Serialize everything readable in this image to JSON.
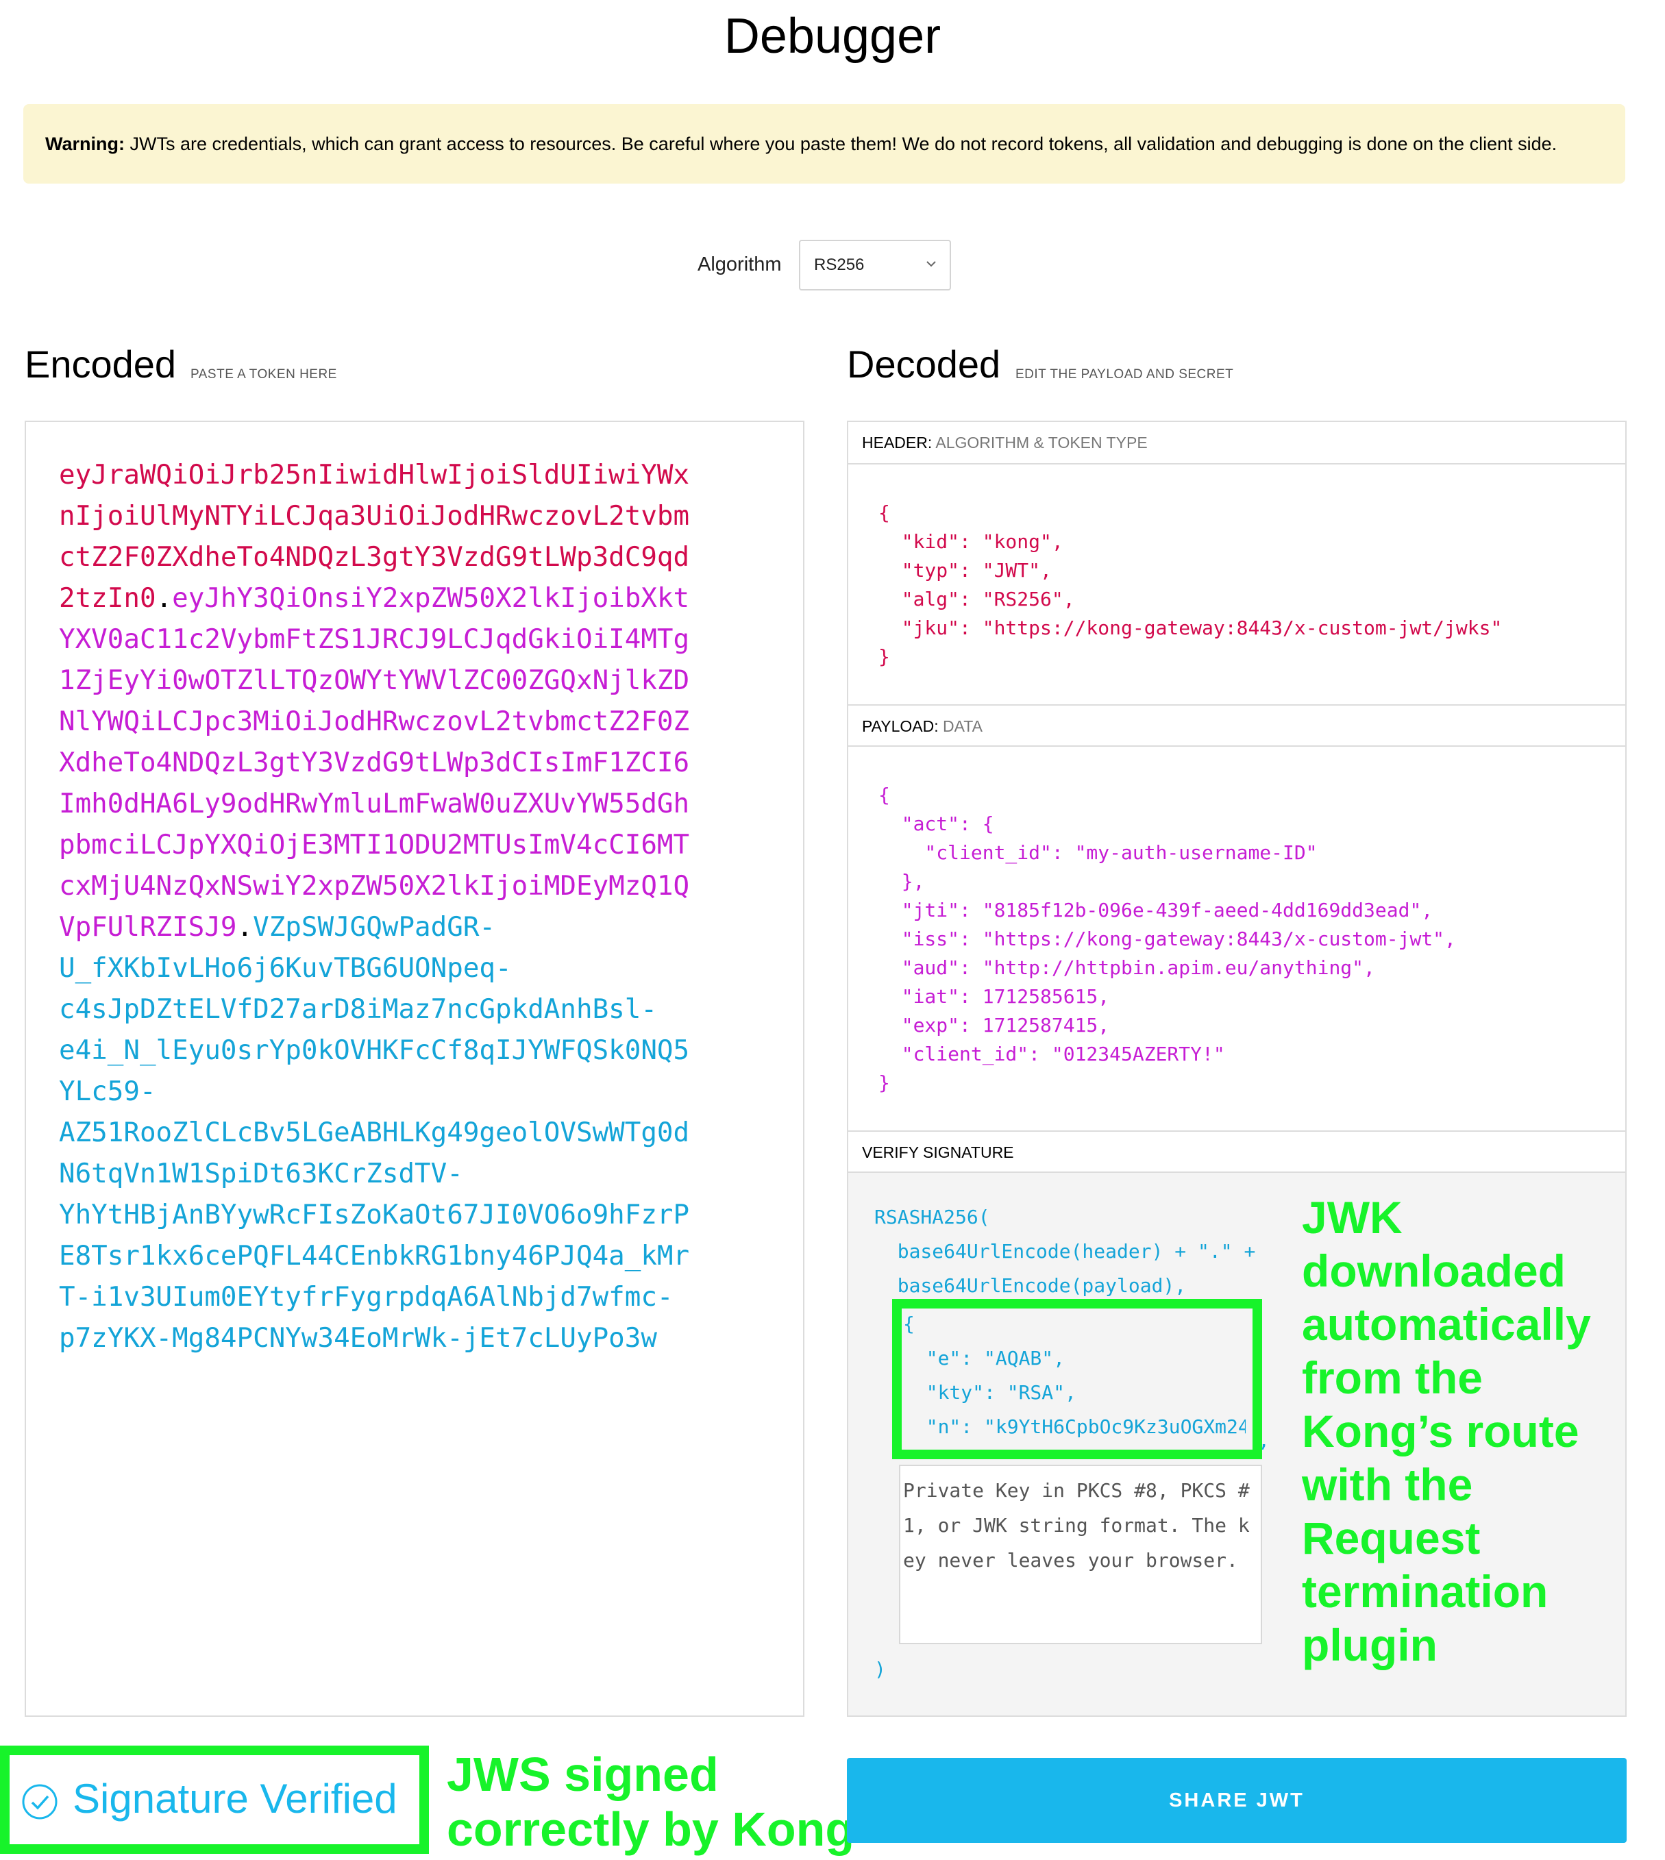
{
  "page_title": "Debugger",
  "warning": {
    "bold": "Warning:",
    "text": " JWTs are credentials, which can grant access to resources. Be careful where you paste them! We do not record tokens, all validation and debugging is done on the client side."
  },
  "algorithm": {
    "label": "Algorithm",
    "value": "RS256"
  },
  "encoded": {
    "title": "Encoded",
    "subtitle": "PASTE A TOKEN HERE",
    "lines": [
      [
        {
          "t": "eyJraWQiOiJrb25nIiwidHlwIjoiSldUIiwiYWx",
          "c": "red"
        }
      ],
      [
        {
          "t": "nIjoiUlMyNTYiLCJqa3UiOiJodHRwczovL2tvbm",
          "c": "red"
        }
      ],
      [
        {
          "t": "ctZ2F0ZXdheTo4NDQzL3gtY3VzdG9tLWp3dC9qd",
          "c": "red"
        }
      ],
      [
        {
          "t": "2tzIn0",
          "c": "red"
        },
        {
          "t": ".",
          "c": "blk"
        },
        {
          "t": "eyJhY3QiOnsiY2xpZW50X2lkIjoibXkt",
          "c": "pur"
        }
      ],
      [
        {
          "t": "YXV0aC11c2VybmFtZS1JRCJ9LCJqdGkiOiI4MTg",
          "c": "pur"
        }
      ],
      [
        {
          "t": "1ZjEyYi0wOTZlLTQzOWYtYWVlZC00ZGQxNjlkZD",
          "c": "pur"
        }
      ],
      [
        {
          "t": "NlYWQiLCJpc3MiOiJodHRwczovL2tvbmctZ2F0Z",
          "c": "pur"
        }
      ],
      [
        {
          "t": "XdheTo4NDQzL3gtY3VzdG9tLWp3dCIsImF1ZCI6",
          "c": "pur"
        }
      ],
      [
        {
          "t": "Imh0dHA6Ly9odHRwYmluLmFwaW0uZXUvYW55dGh",
          "c": "pur"
        }
      ],
      [
        {
          "t": "pbmciLCJpYXQiOjE3MTI1ODU2MTUsImV4cCI6MT",
          "c": "pur"
        }
      ],
      [
        {
          "t": "cxMjU4NzQxNSwiY2xpZW50X2lkIjoiMDEyMzQ1Q",
          "c": "pur"
        }
      ],
      [
        {
          "t": "VpFUlRZISJ9",
          "c": "pur"
        },
        {
          "t": ".",
          "c": "blk"
        },
        {
          "t": "VZpSWJGQwPadGR-",
          "c": "cyn"
        }
      ],
      [
        {
          "t": "U_fXKbIvLHo6j6KuvTBG6UONpeq-",
          "c": "cyn"
        }
      ],
      [
        {
          "t": "c4sJpDZtELVfD27arD8iMaz7ncGpkdAnhBsl-",
          "c": "cyn"
        }
      ],
      [
        {
          "t": "e4i_N_lEyu0srYp0kOVHKFcCf8qIJYWFQSk0NQ5",
          "c": "cyn"
        }
      ],
      [
        {
          "t": "YLc59-",
          "c": "cyn"
        }
      ],
      [
        {
          "t": "AZ51RooZlCLcBv5LGeABHLKg49geolOVSwWTg0d",
          "c": "cyn"
        }
      ],
      [
        {
          "t": "N6tqVn1W1SpiDt63KCrZsdTV-",
          "c": "cyn"
        }
      ],
      [
        {
          "t": "YhYtHBjAnBYywRcFIsZoKaOt67JI0VO6o9hFzrP",
          "c": "cyn"
        }
      ],
      [
        {
          "t": "E8Tsr1kx6cePQFL44CEnbkRG1bny46PJQ4a_kMr",
          "c": "cyn"
        }
      ],
      [
        {
          "t": "T-i1v3UIum0EYtyfrFygrpdqA6AlNbjd7wfmc-",
          "c": "cyn"
        }
      ],
      [
        {
          "t": "p7zYKX-Mg84PCNYw34EoMrWk-jEt7cLUyPo3w",
          "c": "cyn"
        }
      ]
    ]
  },
  "decoded": {
    "title": "Decoded",
    "subtitle": "EDIT THE PAYLOAD AND SECRET",
    "header_label": "HEADER:",
    "header_sub": "ALGORITHM & TOKEN TYPE",
    "header_json": "{\n  \"kid\": \"kong\",\n  \"typ\": \"JWT\",\n  \"alg\": \"RS256\",\n  \"jku\": \"https://kong-gateway:8443/x-custom-jwt/jwks\"\n}",
    "payload_label": "PAYLOAD:",
    "payload_sub": "DATA",
    "payload_json": "{\n  \"act\": {\n    \"client_id\": \"my-auth-username-ID\"\n  },\n  \"jti\": \"8185f12b-096e-439f-aeed-4dd169dd3ead\",\n  \"iss\": \"https://kong-gateway:8443/x-custom-jwt\",\n  \"aud\": \"http://httpbin.apim.eu/anything\",\n  \"iat\": 1712585615,\n  \"exp\": 1712587415,\n  \"client_id\": \"012345AZERTY!\"\n}",
    "verify_label": "VERIFY SIGNATURE",
    "verify_fn": "RSASHA256(",
    "verify_line1": "  base64UrlEncode(header) + \".\" +",
    "verify_line2": "  base64UrlEncode(payload),",
    "jwk_json": "{\n  \"e\": \"AQAB\",\n  \"kty\": \"RSA\",\n  \"n\": \"k9YtH6CpbOc9Kz3uOGXm24",
    "jwk_comma": ",",
    "secret_placeholder": "Private Key in PKCS #8, PKCS #1, or JWK string format. The key never leaves your browser.",
    "verify_close": ")"
  },
  "annotations": {
    "jwk": "JWK downloaded automatically from the Kong's route with the Request termination plugin",
    "jwk_lines": [
      "JWK",
      "downloaded",
      "automatically",
      "from the",
      "Kong’s route",
      "with the",
      "Request",
      "termination",
      "plugin"
    ],
    "jws_lines": [
      "JWS signed",
      "correctly by Kong"
    ]
  },
  "status": {
    "signature": "Signature Verified"
  },
  "share_button": "SHARE JWT",
  "colors": {
    "header": "#d20a4c",
    "payload": "#c61dd4",
    "signature": "#14a4d8",
    "annotation_green": "#17f32a",
    "share_button": "#19b7ec",
    "warning_bg": "#fbf5d2"
  }
}
